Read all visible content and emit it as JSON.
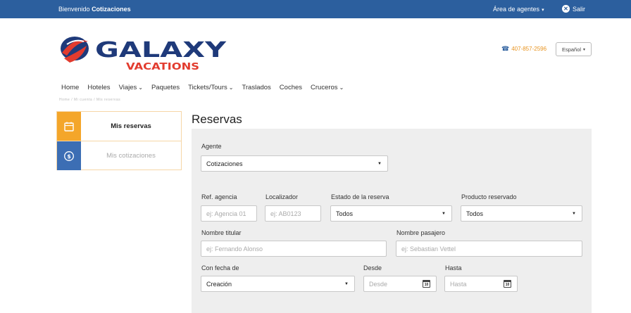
{
  "topbar": {
    "welcome_prefix": "Bienvenido",
    "welcome_user": "Cotizaciones",
    "agents_menu": "Área de agentes",
    "logout": "Salir"
  },
  "header": {
    "logo_word": "GALAXY",
    "logo_sub": "VACATIONS",
    "phone": "407-857-2596",
    "language": "Español"
  },
  "nav": {
    "items": [
      {
        "label": "Home",
        "dropdown": false
      },
      {
        "label": "Hoteles",
        "dropdown": false
      },
      {
        "label": "Viajes",
        "dropdown": true
      },
      {
        "label": "Paquetes",
        "dropdown": false
      },
      {
        "label": "Tickets/Tours",
        "dropdown": true
      },
      {
        "label": "Traslados",
        "dropdown": false
      },
      {
        "label": "Coches",
        "dropdown": false
      },
      {
        "label": "Cruceros",
        "dropdown": true
      }
    ]
  },
  "breadcrumb": "Home / Mi cuenta / Mis reservas",
  "sidebar": {
    "items": [
      {
        "label": "Mis reservas",
        "icon": "calendar-icon",
        "active": true
      },
      {
        "label": "Mis cotizaciones",
        "icon": "dollar-icon",
        "active": false
      }
    ]
  },
  "page_title": "Reservas",
  "form": {
    "agent": {
      "label": "Agente",
      "value": "Cotizaciones"
    },
    "agency_ref": {
      "label": "Ref. agencia",
      "placeholder": "ej: Agencia 01"
    },
    "locator": {
      "label": "Localizador",
      "placeholder": "ej: AB0123"
    },
    "status": {
      "label": "Estado de la reserva",
      "value": "Todos"
    },
    "product": {
      "label": "Producto reservado",
      "value": "Todos"
    },
    "holder": {
      "label": "Nombre titular",
      "placeholder": "ej: Fernando Alonso"
    },
    "passenger": {
      "label": "Nombre pasajero",
      "placeholder": "ej: Sebastian Vettel"
    },
    "date_type": {
      "label": "Con fecha de",
      "value": "Creación"
    },
    "from": {
      "label": "Desde",
      "placeholder": "Desde"
    },
    "to": {
      "label": "Hasta",
      "placeholder": "Hasta"
    },
    "calendar_day": "10"
  },
  "colors": {
    "topbar": "#2c5f9e",
    "accent_orange": "#f4a62a",
    "accent_blue": "#3c6eb4",
    "panel_bg": "#eeeeee",
    "logo_navy": "#1f3a7a",
    "logo_red": "#e23b2e"
  }
}
